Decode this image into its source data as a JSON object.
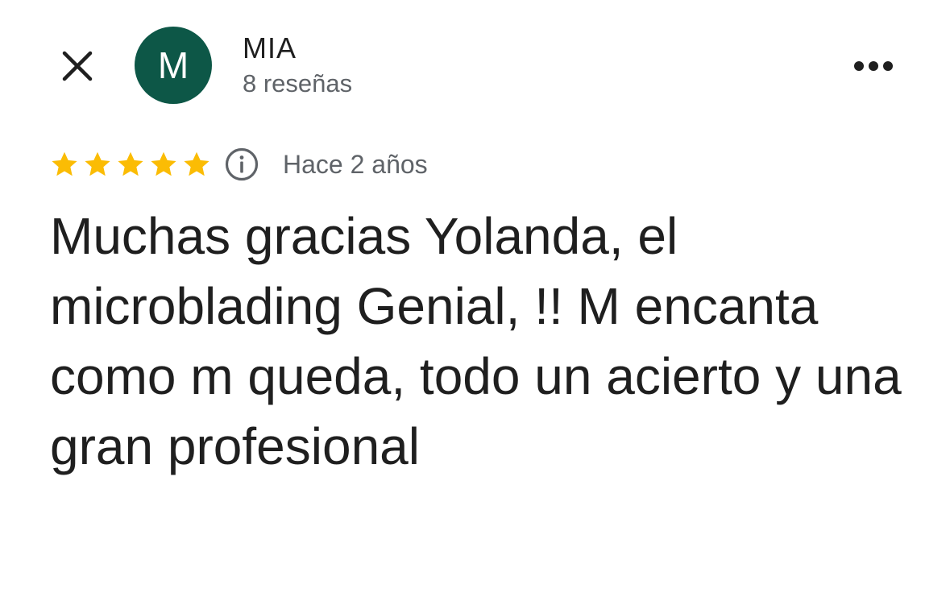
{
  "header": {
    "close_icon": "close-icon",
    "avatar_initial": "M",
    "avatar_color": "#0d5747",
    "author_name": "MIA",
    "review_count": "8 reseñas",
    "more_icon": "more-horizontal-icon"
  },
  "review": {
    "rating": 5,
    "rating_max": 5,
    "star_color": "#fbbc04",
    "info_icon": "info-icon",
    "date": "Hace 2 años",
    "text": "Muchas gracias Yolanda, el microblading Genial, !! M encanta como m queda, todo un acierto y una gran profesional"
  }
}
